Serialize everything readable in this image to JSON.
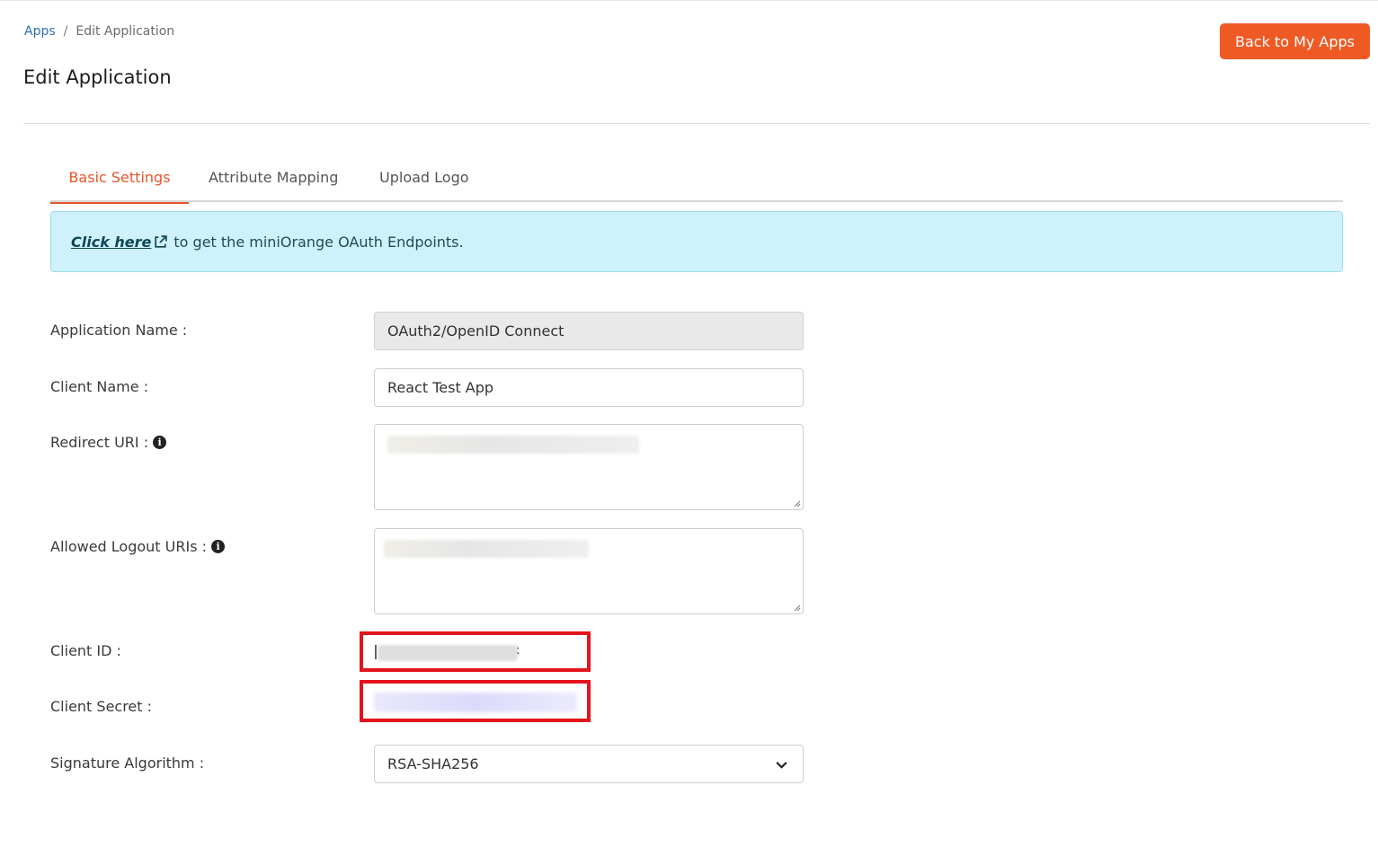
{
  "breadcrumb": {
    "root": "Apps",
    "separator": "/",
    "current": "Edit Application"
  },
  "page_title": "Edit Application",
  "back_button": "Back to My Apps",
  "tabs": [
    {
      "label": "Basic Settings",
      "active": true
    },
    {
      "label": "Attribute Mapping",
      "active": false
    },
    {
      "label": "Upload Logo",
      "active": false
    }
  ],
  "banner": {
    "link_text": "Click here",
    "text": "to get the miniOrange OAuth Endpoints."
  },
  "form": {
    "application_name": {
      "label": "Application Name :",
      "value": "OAuth2/OpenID Connect"
    },
    "client_name": {
      "label": "Client Name :",
      "value": "React Test App"
    },
    "redirect_uri": {
      "label": "Redirect URI :"
    },
    "logout_uris": {
      "label": "Allowed Logout URIs :"
    },
    "client_id": {
      "label": "Client ID :"
    },
    "client_secret": {
      "label": "Client Secret :"
    },
    "signature_algorithm": {
      "label": "Signature Algorithm :",
      "value": "RSA-SHA256"
    }
  },
  "colors": {
    "accent": "#ef5a24",
    "highlight_box": "#e3141b",
    "banner_bg": "#cff1fb"
  }
}
